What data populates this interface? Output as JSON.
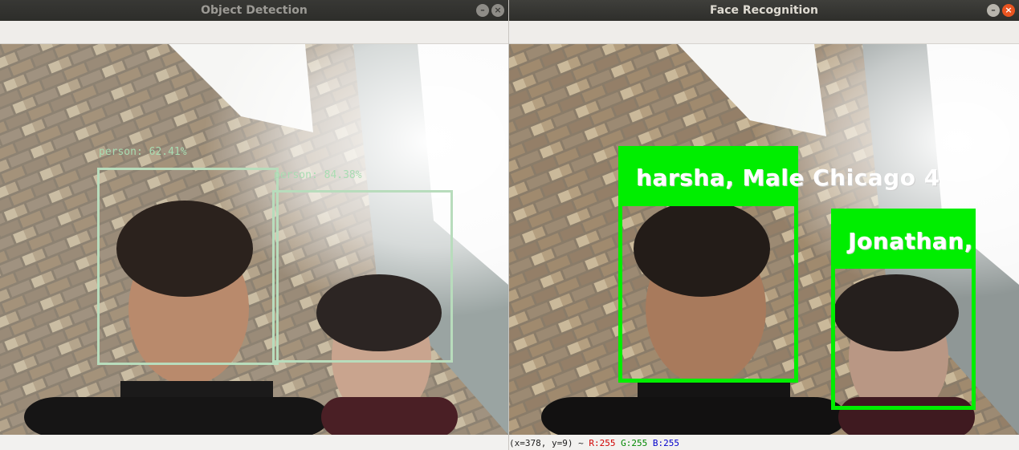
{
  "left_window": {
    "title": "Object Detection",
    "detections": [
      {
        "label": "person: 62.41%"
      },
      {
        "label": "person: 84.38%"
      }
    ]
  },
  "right_window": {
    "title": "Face Recognition",
    "faces": [
      {
        "label": "harsha, Male Chicago 4"
      },
      {
        "label": "Jonathan,"
      }
    ]
  },
  "status": {
    "coords": "(x=378, y=9) ~",
    "r": "R:255",
    "g": "G:255",
    "b": "B:255"
  },
  "window_buttons": {
    "minimize_glyph": "–",
    "close_glyph": "×"
  },
  "colors": {
    "detection_box": "#b8dcbc",
    "face_box": "#00ee00",
    "titlebar": "#2e2e2b",
    "close_button_active": "#e95420"
  }
}
